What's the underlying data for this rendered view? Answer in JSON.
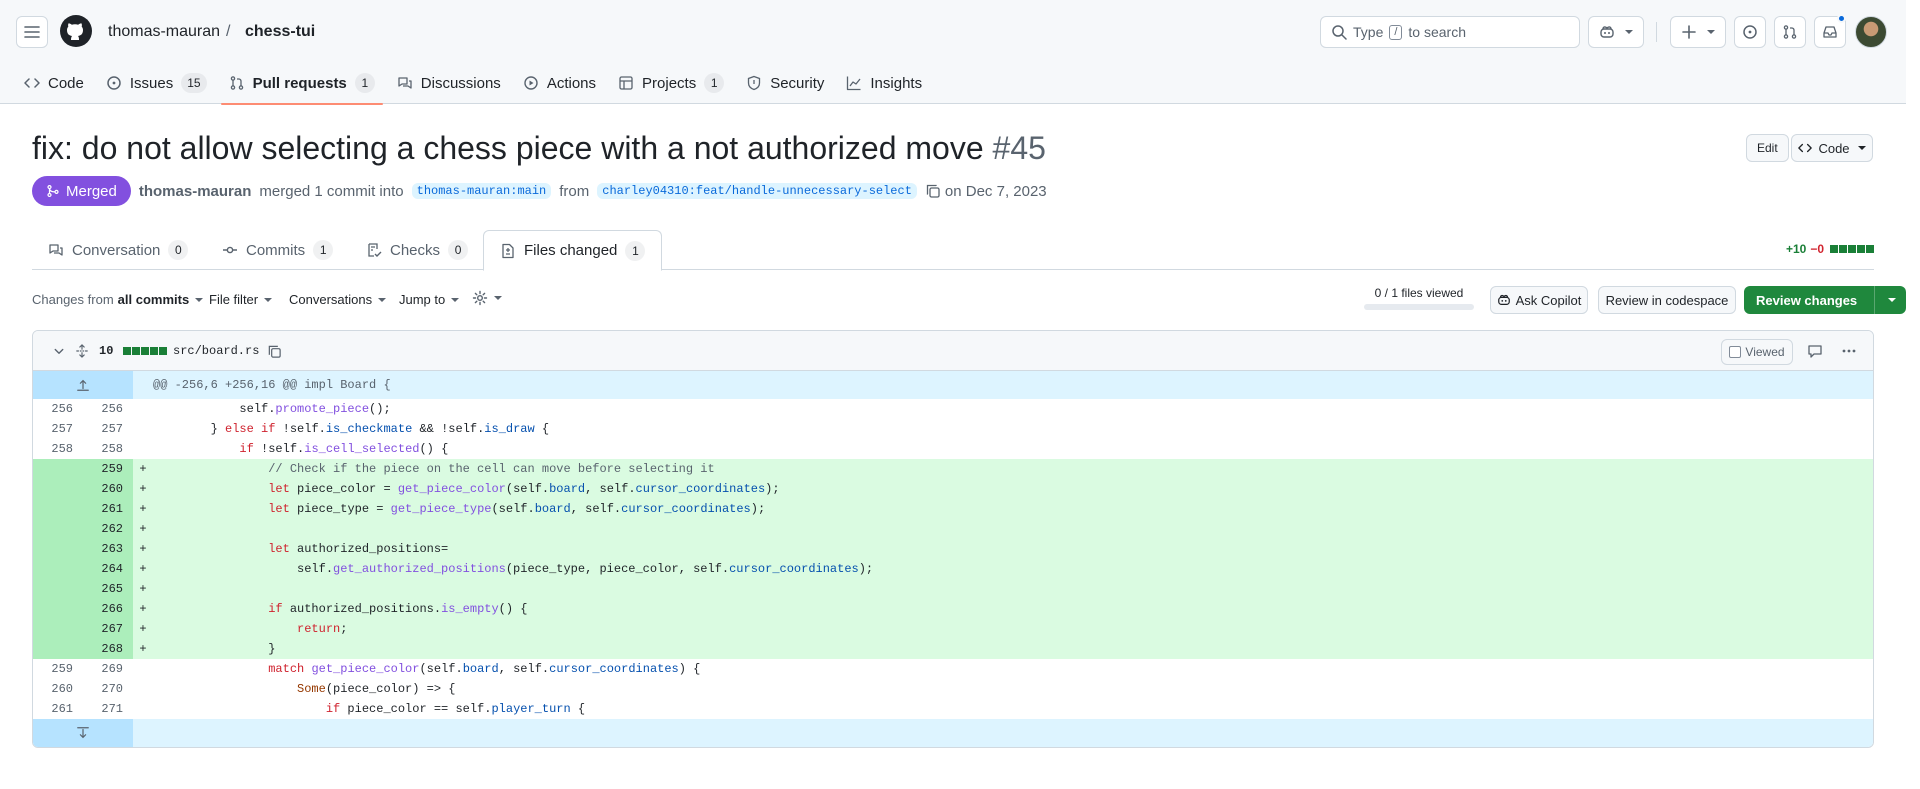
{
  "header": {
    "owner": "thomas-mauran",
    "separator": "/",
    "repo": "chess-tui",
    "search_prefix": "Type",
    "search_key": "/",
    "search_suffix": "to search"
  },
  "repo_nav": [
    {
      "label": "Code",
      "icon": "code-icon"
    },
    {
      "label": "Issues",
      "count": "15",
      "icon": "issue-icon"
    },
    {
      "label": "Pull requests",
      "count": "1",
      "icon": "pull-request-icon",
      "active": true
    },
    {
      "label": "Discussions",
      "icon": "discussion-icon"
    },
    {
      "label": "Actions",
      "icon": "play-icon"
    },
    {
      "label": "Projects",
      "count": "1",
      "icon": "table-icon"
    },
    {
      "label": "Security",
      "icon": "shield-icon"
    },
    {
      "label": "Insights",
      "icon": "graph-icon"
    }
  ],
  "pr": {
    "title": "fix: do not allow selecting a chess piece with a not authorized move",
    "number": "#45",
    "edit_label": "Edit",
    "code_label": "Code",
    "state": "Merged",
    "author": "thomas-mauran",
    "merged_text": "merged 1 commit into",
    "base_branch": "thomas-mauran:main",
    "from_text": "from",
    "head_branch": "charley04310:feat/handle-unnecessary-select",
    "date_text": "on Dec 7, 2023"
  },
  "pr_tabs": [
    {
      "label": "Conversation",
      "count": "0"
    },
    {
      "label": "Commits",
      "count": "1"
    },
    {
      "label": "Checks",
      "count": "0"
    },
    {
      "label": "Files changed",
      "count": "1",
      "active": true
    }
  ],
  "diffstat": {
    "additions": "+10",
    "deletions": "−0"
  },
  "toolbar": {
    "changes_prefix": "Changes from",
    "changes_value": "all commits",
    "file_filter": "File filter",
    "conversations": "Conversations",
    "jump_to": "Jump to",
    "files_viewed": "0 / 1 files viewed",
    "files_viewed_fraction": 0,
    "ask_copilot": "Ask Copilot",
    "review_codespace": "Review in codespace",
    "review_changes": "Review changes"
  },
  "file": {
    "changes": "10",
    "path": "src/board.rs",
    "viewed_label": "Viewed",
    "hunk_header": "@@ -256,6 +256,16 @@ impl Board {"
  },
  "diff_lines": [
    {
      "type": "ctx",
      "old": "256",
      "new": "256",
      "sign": " ",
      "code": "            self.promote_piece();"
    },
    {
      "type": "ctx",
      "old": "257",
      "new": "257",
      "sign": " ",
      "code": "        } else if !self.is_checkmate && !self.is_draw {"
    },
    {
      "type": "ctx",
      "old": "258",
      "new": "258",
      "sign": " ",
      "code": "            if !self.is_cell_selected() {"
    },
    {
      "type": "add",
      "old": "",
      "new": "259",
      "sign": "+",
      "code": "                // Check if the piece on the cell can move before selecting it"
    },
    {
      "type": "add",
      "old": "",
      "new": "260",
      "sign": "+",
      "code": "                let piece_color = get_piece_color(self.board, self.cursor_coordinates);"
    },
    {
      "type": "add",
      "old": "",
      "new": "261",
      "sign": "+",
      "code": "                let piece_type = get_piece_type(self.board, self.cursor_coordinates);"
    },
    {
      "type": "add",
      "old": "",
      "new": "262",
      "sign": "+",
      "code": ""
    },
    {
      "type": "add",
      "old": "",
      "new": "263",
      "sign": "+",
      "code": "                let authorized_positions="
    },
    {
      "type": "add",
      "old": "",
      "new": "264",
      "sign": "+",
      "code": "                    self.get_authorized_positions(piece_type, piece_color, self.cursor_coordinates);"
    },
    {
      "type": "add",
      "old": "",
      "new": "265",
      "sign": "+",
      "code": ""
    },
    {
      "type": "add",
      "old": "",
      "new": "266",
      "sign": "+",
      "code": "                if authorized_positions.is_empty() {"
    },
    {
      "type": "add",
      "old": "",
      "new": "267",
      "sign": "+",
      "code": "                    return;"
    },
    {
      "type": "add",
      "old": "",
      "new": "268",
      "sign": "+",
      "code": "                }"
    },
    {
      "type": "ctx",
      "old": "259",
      "new": "269",
      "sign": " ",
      "code": "                match get_piece_color(self.board, self.cursor_coordinates) {"
    },
    {
      "type": "ctx",
      "old": "260",
      "new": "270",
      "sign": " ",
      "code": "                    Some(piece_color) => {"
    },
    {
      "type": "ctx",
      "old": "261",
      "new": "271",
      "sign": " ",
      "code": "                        if piece_color == self.player_turn {"
    }
  ],
  "colors": {
    "merged": "#8250df",
    "addition": "#1a7f37",
    "deletion": "#d1242f",
    "accent": "#fd8c73"
  }
}
